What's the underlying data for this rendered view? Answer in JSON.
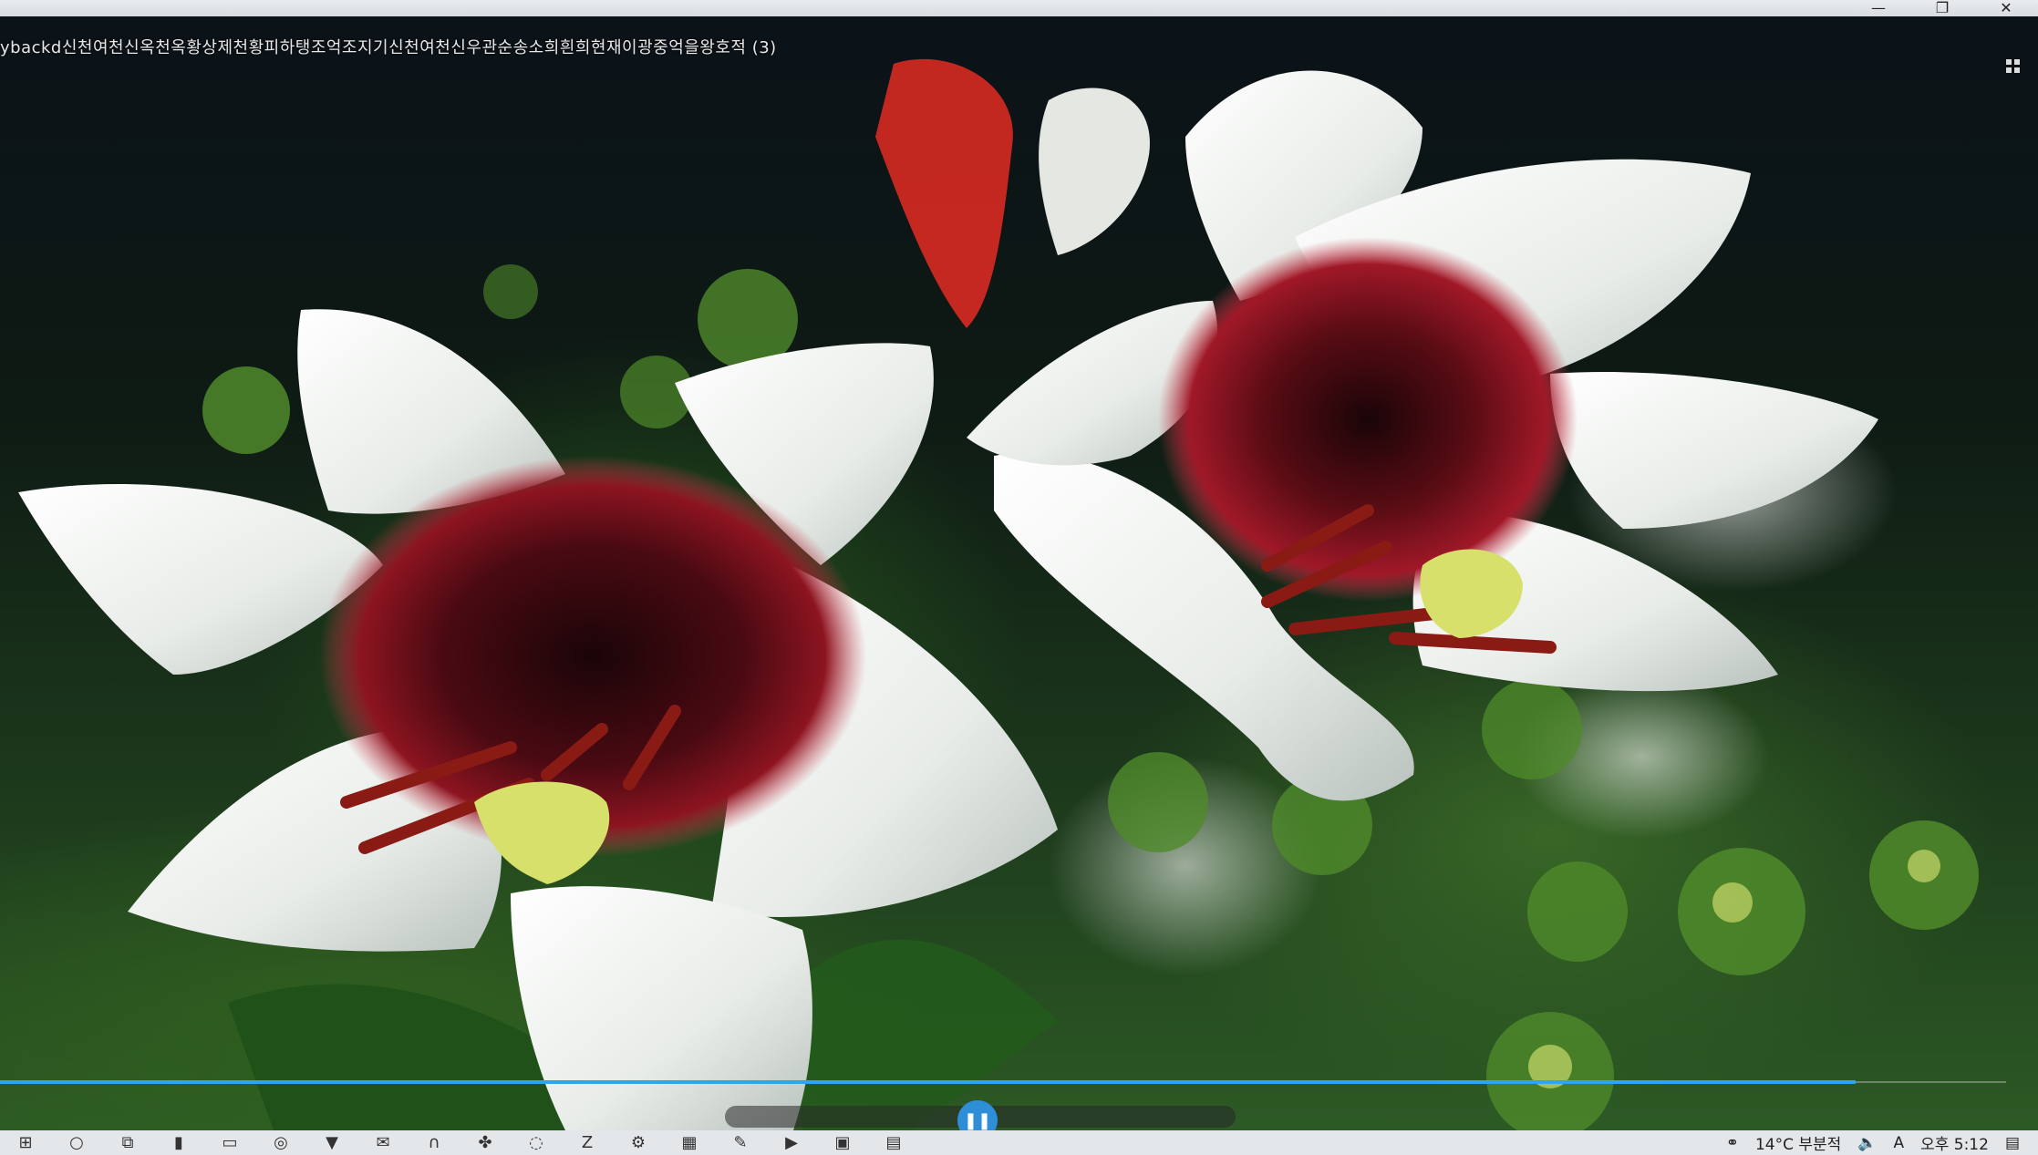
{
  "window": {
    "title": "ybackd신천여천신옥천옥황상제천황피하탱조억조지기신천여천신우관순송소희흰희현재이광중억을왕호적 (3)",
    "minimize": "—",
    "restore": "❐",
    "close": "✕"
  },
  "player": {
    "progress_fraction": 0.925,
    "play_state": "pause"
  },
  "colors": {
    "seek_fill": "#29a8f0",
    "taskbar": "#e4e7ea",
    "titlebar": "#e4e7ea"
  },
  "taskbar": {
    "apps": [
      {
        "icon": "windows-start-icon",
        "glyph": "⊞"
      },
      {
        "icon": "search-icon",
        "glyph": "○"
      },
      {
        "icon": "task-view-icon",
        "glyph": "⧉"
      },
      {
        "icon": "office-icon",
        "glyph": "▮"
      },
      {
        "icon": "file-explorer-icon",
        "glyph": "▭"
      },
      {
        "icon": "edge-icon",
        "glyph": "◎"
      },
      {
        "icon": "mcafee-icon",
        "glyph": "▼"
      },
      {
        "icon": "mail-icon",
        "glyph": "✉"
      },
      {
        "icon": "headset-icon",
        "glyph": "∩"
      },
      {
        "icon": "puzzle-icon",
        "glyph": "✤"
      },
      {
        "icon": "chat-icon",
        "glyph": "◌"
      },
      {
        "icon": "filezilla-icon",
        "glyph": "Z"
      },
      {
        "icon": "settings-icon",
        "glyph": "⚙"
      },
      {
        "icon": "chart-app-icon",
        "glyph": "▦"
      },
      {
        "icon": "paint-icon",
        "glyph": "✎"
      },
      {
        "icon": "media-icon",
        "glyph": "▶"
      },
      {
        "icon": "photo-icon",
        "glyph": "▣"
      },
      {
        "icon": "video-app-icon",
        "glyph": "▤"
      }
    ],
    "tray": {
      "weather": "14°C 부분적",
      "clock": "오후 5:12"
    }
  }
}
